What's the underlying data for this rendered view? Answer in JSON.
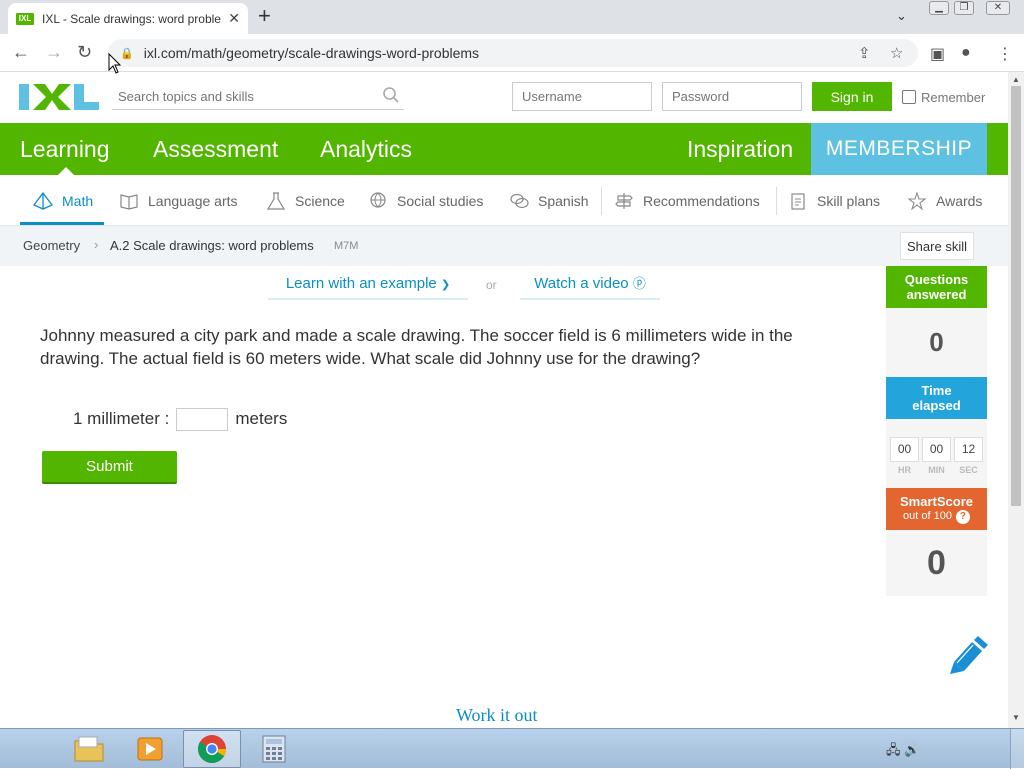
{
  "browser": {
    "tab_title": "IXL - Scale drawings: word proble",
    "favicon_text": "IXL",
    "url": "ixl.com/math/geometry/scale-drawings-word-problems"
  },
  "header": {
    "search_placeholder": "Search topics and skills",
    "username_placeholder": "Username",
    "password_placeholder": "Password",
    "signin_label": "Sign in",
    "remember_label": "Remember"
  },
  "green_nav": {
    "learning": "Learning",
    "assessment": "Assessment",
    "analytics": "Analytics",
    "inspiration": "Inspiration",
    "membership": "MEMBERSHIP"
  },
  "subject_nav": {
    "items": [
      {
        "label": "Math",
        "icon": "math-pyramid-icon",
        "active": true
      },
      {
        "label": "Language arts",
        "icon": "book-icon"
      },
      {
        "label": "Science",
        "icon": "flask-icon"
      },
      {
        "label": "Social studies",
        "icon": "globe-icon"
      },
      {
        "label": "Spanish",
        "icon": "speech-bubbles-icon"
      },
      {
        "label": "Recommendations",
        "icon": "signpost-icon"
      },
      {
        "label": "Skill plans",
        "icon": "clipboard-icon"
      },
      {
        "label": "Awards",
        "icon": "award-icon"
      }
    ]
  },
  "breadcrumb": {
    "subject": "Geometry",
    "skill": "A.2 Scale drawings: word problems",
    "code": "M7M",
    "share_label": "Share skill"
  },
  "learn": {
    "example_label": "Learn with an example",
    "or_label": "or",
    "video_label": "Watch a video"
  },
  "problem": {
    "question": "Johnny measured a city park and made a scale drawing. The soccer field is 6 millimeters wide in the drawing. The actual field is 60 meters wide. What scale did Johnny use for the drawing?",
    "prefix": "1 millimeter :",
    "answer_value": "",
    "suffix": "meters",
    "submit_label": "Submit"
  },
  "sidebar": {
    "questions_label": "Questions answered",
    "questions_value": "0",
    "time_label": "Time elapsed",
    "hr": "00",
    "min": "00",
    "sec": "12",
    "hr_label": "HR",
    "min_label": "MIN",
    "sec_label": "SEC",
    "smartscore_label": "SmartScore",
    "smartscore_sub": "out of 100",
    "smartscore_value": "0"
  },
  "work_it_out": "Work it out",
  "colors": {
    "ixl_green": "#52b500",
    "ixl_blue": "#0a8fc2",
    "membership_teal": "#5ec1e2",
    "smartscore_orange": "#e3652f",
    "time_blue": "#23a5db"
  }
}
